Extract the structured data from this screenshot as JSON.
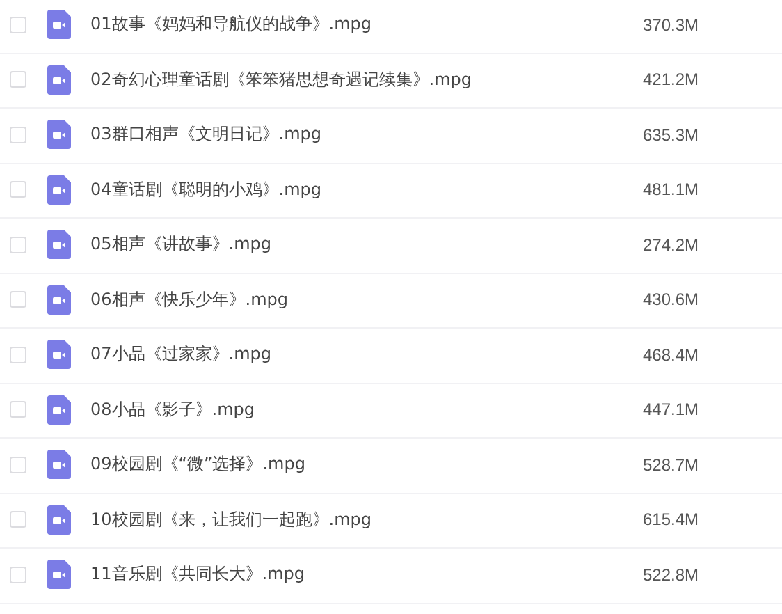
{
  "files": [
    {
      "name": "01故事《妈妈和导航仪的战争》.mpg",
      "size": "370.3M",
      "checked": false
    },
    {
      "name": "02奇幻心理童话剧《笨笨猪思想奇遇记续集》.mpg",
      "size": "421.2M",
      "checked": false
    },
    {
      "name": "03群口相声《文明日记》.mpg",
      "size": "635.3M",
      "checked": false
    },
    {
      "name": "04童话剧《聪明的小鸡》.mpg",
      "size": "481.1M",
      "checked": false
    },
    {
      "name": "05相声《讲故事》.mpg",
      "size": "274.2M",
      "checked": false
    },
    {
      "name": "06相声《快乐少年》.mpg",
      "size": "430.6M",
      "checked": false
    },
    {
      "name": "07小品《过家家》.mpg",
      "size": "468.4M",
      "checked": false
    },
    {
      "name": "08小品《影子》.mpg",
      "size": "447.1M",
      "checked": false
    },
    {
      "name": "09校园剧《“微”选择》.mpg",
      "size": "528.7M",
      "checked": false
    },
    {
      "name": "10校园剧《来，让我们一起跑》.mpg",
      "size": "615.4M",
      "checked": false
    },
    {
      "name": "11音乐剧《共同长大》.mpg",
      "size": "522.8M",
      "checked": false
    }
  ]
}
